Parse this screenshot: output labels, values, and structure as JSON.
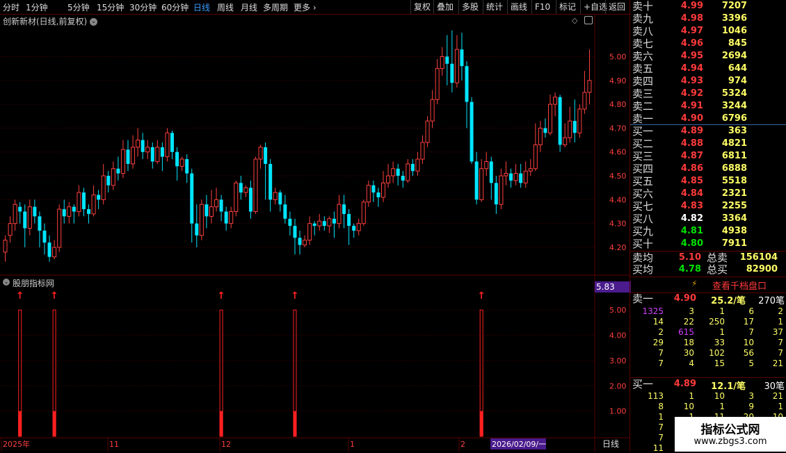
{
  "toolbar": {
    "periods": [
      "分时",
      "1分钟",
      "5分钟",
      "15分钟",
      "30分钟",
      "60分钟",
      "日线",
      "周线",
      "月线",
      "多周期",
      "更多"
    ],
    "active_period": "日线",
    "actions": [
      "复权",
      "叠加",
      "多股",
      "统计",
      "画线",
      "F10",
      "标记",
      "+自选",
      "返回"
    ]
  },
  "stock": {
    "title": "创新新材(日线,前复权)"
  },
  "indicator": {
    "title": "股朋指标网",
    "current_value": "5.83"
  },
  "price_axis": [
    "5.00",
    "4.90",
    "4.80",
    "4.70",
    "4.60",
    "4.50",
    "4.40",
    "4.30",
    "4.20"
  ],
  "ind_axis": [
    "5.00",
    "4.00",
    "3.00",
    "2.00",
    "1.00"
  ],
  "x_axis": {
    "labels": [
      "2025年",
      "11",
      "12",
      "1",
      "2"
    ],
    "cursor_date": "2026/02/09/一",
    "period_label": "日线"
  },
  "orderbook": {
    "asks": [
      {
        "label": "卖十",
        "price": "4.99",
        "vol": "7207"
      },
      {
        "label": "卖九",
        "price": "4.98",
        "vol": "3396"
      },
      {
        "label": "卖八",
        "price": "4.97",
        "vol": "1046"
      },
      {
        "label": "卖七",
        "price": "4.96",
        "vol": "845"
      },
      {
        "label": "卖六",
        "price": "4.95",
        "vol": "2694"
      },
      {
        "label": "卖五",
        "price": "4.94",
        "vol": "644"
      },
      {
        "label": "卖四",
        "price": "4.93",
        "vol": "974"
      },
      {
        "label": "卖三",
        "price": "4.92",
        "vol": "5324"
      },
      {
        "label": "卖二",
        "price": "4.91",
        "vol": "3244"
      },
      {
        "label": "卖一",
        "price": "4.90",
        "vol": "6796"
      }
    ],
    "bids": [
      {
        "label": "买一",
        "price": "4.89",
        "vol": "363",
        "color": "red"
      },
      {
        "label": "买二",
        "price": "4.88",
        "vol": "4821",
        "color": "red"
      },
      {
        "label": "买三",
        "price": "4.87",
        "vol": "6811",
        "color": "red"
      },
      {
        "label": "买四",
        "price": "4.86",
        "vol": "6888",
        "color": "red"
      },
      {
        "label": "买五",
        "price": "4.85",
        "vol": "5518",
        "color": "red"
      },
      {
        "label": "买六",
        "price": "4.84",
        "vol": "2321",
        "color": "red"
      },
      {
        "label": "买七",
        "price": "4.83",
        "vol": "2255",
        "color": "red"
      },
      {
        "label": "买八",
        "price": "4.82",
        "vol": "3364",
        "color": "white"
      },
      {
        "label": "买九",
        "price": "4.81",
        "vol": "4938",
        "color": "green"
      },
      {
        "label": "买十",
        "price": "4.80",
        "vol": "7911",
        "color": "green"
      }
    ],
    "ask_avg_label": "卖均",
    "ask_avg": "5.10",
    "total_ask_label": "总卖",
    "total_ask": "156104",
    "bid_avg_label": "买均",
    "bid_avg": "4.78",
    "total_bid_label": "总买",
    "total_bid": "82900"
  },
  "depth": {
    "button": "查看千档盘口",
    "ask1": {
      "label": "卖一",
      "price": "4.90",
      "avg": "25.2/笔",
      "count": "270笔"
    },
    "ask_rows": [
      [
        "1325",
        "3",
        "1",
        "6",
        "2"
      ],
      [
        "14",
        "22",
        "250",
        "17",
        "1"
      ],
      [
        "2",
        "615",
        "1",
        "7",
        "37"
      ],
      [
        "29",
        "18",
        "33",
        "10",
        "7"
      ],
      [
        "7",
        "30",
        "102",
        "56",
        "7"
      ],
      [
        "7",
        "4",
        "15",
        "5",
        "21"
      ]
    ],
    "bid1": {
      "label": "买一",
      "price": "4.89",
      "avg": "12.1/笔",
      "count": "30笔"
    },
    "bid_rows": [
      [
        "113",
        "1",
        "10",
        "3",
        "21"
      ],
      [
        "8",
        "10",
        "1",
        "9",
        "1"
      ],
      [
        "1",
        "1",
        "11",
        "20",
        "10"
      ],
      [
        "7",
        "",
        "",
        "",
        ""
      ],
      [
        "7",
        "",
        "",
        "",
        ""
      ],
      [
        "11",
        "",
        "",
        "",
        ""
      ]
    ]
  },
  "watermark": {
    "name": "指标公式网",
    "url": "www.zbgs3.com"
  },
  "chart_data": {
    "type": "candlestick",
    "price_range": [
      4.13,
      5.15
    ],
    "candles": [
      [
        4.18,
        4.23,
        4.14,
        4.25
      ],
      [
        4.25,
        4.3,
        4.22,
        4.33
      ],
      [
        4.3,
        4.38,
        4.27,
        4.4
      ],
      [
        4.37,
        4.35,
        4.3,
        4.39
      ],
      [
        4.35,
        4.28,
        4.2,
        4.38
      ],
      [
        4.28,
        4.37,
        4.25,
        4.4
      ],
      [
        4.37,
        4.33,
        4.3,
        4.4
      ],
      [
        4.33,
        4.27,
        4.2,
        4.35
      ],
      [
        4.27,
        4.22,
        4.17,
        4.3
      ],
      [
        4.22,
        4.16,
        4.14,
        4.25
      ],
      [
        4.16,
        4.2,
        4.15,
        4.23
      ],
      [
        4.2,
        4.36,
        4.18,
        4.38
      ],
      [
        4.36,
        4.33,
        4.3,
        4.4
      ],
      [
        4.33,
        4.37,
        4.3,
        4.39
      ],
      [
        4.37,
        4.35,
        4.3,
        4.38
      ],
      [
        4.35,
        4.43,
        4.33,
        4.46
      ],
      [
        4.43,
        4.36,
        4.33,
        4.45
      ],
      [
        4.36,
        4.34,
        4.3,
        4.38
      ],
      [
        4.34,
        4.42,
        4.33,
        4.46
      ],
      [
        4.42,
        4.4,
        4.36,
        4.44
      ],
      [
        4.4,
        4.5,
        4.38,
        4.55
      ],
      [
        4.5,
        4.46,
        4.43,
        4.52
      ],
      [
        4.46,
        4.53,
        4.44,
        4.56
      ],
      [
        4.53,
        4.51,
        4.48,
        4.58
      ],
      [
        4.51,
        4.61,
        4.49,
        4.65
      ],
      [
        4.61,
        4.55,
        4.52,
        4.65
      ],
      [
        4.55,
        4.62,
        4.53,
        4.67
      ],
      [
        4.62,
        4.65,
        4.58,
        4.7
      ],
      [
        4.65,
        4.6,
        4.57,
        4.68
      ],
      [
        4.6,
        4.62,
        4.57,
        4.65
      ],
      [
        4.62,
        4.56,
        4.53,
        4.64
      ],
      [
        4.56,
        4.62,
        4.55,
        4.65
      ],
      [
        4.62,
        4.58,
        4.52,
        4.64
      ],
      [
        4.58,
        4.68,
        4.56,
        4.7
      ],
      [
        4.68,
        4.6,
        4.57,
        4.69
      ],
      [
        4.6,
        4.54,
        4.48,
        4.62
      ],
      [
        4.54,
        4.57,
        4.52,
        4.58
      ],
      [
        4.57,
        4.51,
        4.47,
        4.59
      ],
      [
        4.51,
        4.3,
        4.22,
        4.53
      ],
      [
        4.3,
        4.25,
        4.2,
        4.38
      ],
      [
        4.25,
        4.38,
        4.23,
        4.4
      ],
      [
        4.38,
        4.33,
        4.28,
        4.42
      ],
      [
        4.33,
        4.37,
        4.3,
        4.44
      ],
      [
        4.37,
        4.4,
        4.35,
        4.45
      ],
      [
        4.4,
        4.35,
        4.31,
        4.42
      ],
      [
        4.35,
        4.3,
        4.27,
        4.37
      ],
      [
        4.3,
        4.35,
        4.28,
        4.37
      ],
      [
        4.35,
        4.47,
        4.33,
        4.48
      ],
      [
        4.47,
        4.43,
        4.4,
        4.5
      ],
      [
        4.43,
        4.45,
        4.41,
        4.46
      ],
      [
        4.45,
        4.35,
        4.32,
        4.48
      ],
      [
        4.35,
        4.57,
        4.34,
        4.58
      ],
      [
        4.57,
        4.62,
        4.53,
        4.63
      ],
      [
        4.62,
        4.55,
        4.4,
        4.64
      ],
      [
        4.55,
        4.4,
        4.35,
        4.57
      ],
      [
        4.4,
        4.43,
        4.38,
        4.45
      ],
      [
        4.43,
        4.38,
        4.35,
        4.44
      ],
      [
        4.38,
        4.32,
        4.3,
        4.42
      ],
      [
        4.32,
        4.29,
        4.25,
        4.35
      ],
      [
        4.29,
        4.24,
        4.17,
        4.32
      ],
      [
        4.24,
        4.21,
        4.17,
        4.27
      ],
      [
        4.21,
        4.23,
        4.2,
        4.25
      ],
      [
        4.23,
        4.3,
        4.21,
        4.33
      ],
      [
        4.3,
        4.29,
        4.25,
        4.31
      ],
      [
        4.29,
        4.31,
        4.27,
        4.34
      ],
      [
        4.31,
        4.29,
        4.27,
        4.33
      ],
      [
        4.29,
        4.32,
        4.26,
        4.33
      ],
      [
        4.32,
        4.3,
        4.24,
        4.35
      ],
      [
        4.3,
        4.38,
        4.28,
        4.42
      ],
      [
        4.38,
        4.34,
        4.28,
        4.42
      ],
      [
        4.34,
        4.29,
        4.21,
        4.36
      ],
      [
        4.29,
        4.27,
        4.24,
        4.3
      ],
      [
        4.27,
        4.3,
        4.25,
        4.32
      ],
      [
        4.3,
        4.39,
        4.29,
        4.4
      ],
      [
        4.39,
        4.46,
        4.37,
        4.48
      ],
      [
        4.46,
        4.43,
        4.39,
        4.48
      ],
      [
        4.43,
        4.41,
        4.37,
        4.45
      ],
      [
        4.41,
        4.47,
        4.39,
        4.52
      ],
      [
        4.47,
        4.5,
        4.45,
        4.55
      ],
      [
        4.5,
        4.53,
        4.47,
        4.56
      ],
      [
        4.53,
        4.5,
        4.46,
        4.55
      ],
      [
        4.5,
        4.48,
        4.45,
        4.52
      ],
      [
        4.48,
        4.55,
        4.47,
        4.57
      ],
      [
        4.55,
        4.52,
        4.5,
        4.57
      ],
      [
        4.52,
        4.57,
        4.5,
        4.6
      ],
      [
        4.57,
        4.64,
        4.55,
        4.67
      ],
      [
        4.64,
        4.73,
        4.62,
        4.75
      ],
      [
        4.73,
        4.82,
        4.7,
        4.86
      ],
      [
        4.82,
        4.95,
        4.8,
        4.99
      ],
      [
        4.95,
        5.0,
        4.92,
        5.04
      ],
      [
        5.0,
        4.97,
        4.88,
        5.09
      ],
      [
        4.97,
        4.89,
        4.85,
        5.11
      ],
      [
        4.89,
        5.03,
        4.87,
        5.09
      ],
      [
        5.03,
        4.96,
        4.9,
        5.1
      ],
      [
        4.96,
        4.81,
        4.7,
        4.98
      ],
      [
        4.81,
        4.56,
        4.55,
        4.83
      ],
      [
        4.56,
        4.4,
        4.38,
        4.6
      ],
      [
        4.4,
        4.53,
        4.39,
        4.57
      ],
      [
        4.53,
        4.56,
        4.5,
        4.6
      ],
      [
        4.56,
        4.47,
        4.4,
        4.58
      ],
      [
        4.47,
        4.38,
        4.34,
        4.5
      ],
      [
        4.38,
        4.5,
        4.36,
        4.53
      ],
      [
        4.5,
        4.51,
        4.46,
        4.56
      ],
      [
        4.51,
        4.48,
        4.45,
        4.53
      ],
      [
        4.48,
        4.51,
        4.46,
        4.55
      ],
      [
        4.51,
        4.47,
        4.45,
        4.55
      ],
      [
        4.47,
        4.52,
        4.45,
        4.56
      ],
      [
        4.52,
        4.53,
        4.5,
        4.57
      ],
      [
        4.53,
        4.63,
        4.52,
        4.72
      ],
      [
        4.63,
        4.7,
        4.6,
        4.73
      ],
      [
        4.7,
        4.68,
        4.66,
        4.74
      ],
      [
        4.68,
        4.8,
        4.67,
        4.84
      ],
      [
        4.8,
        4.83,
        4.75,
        4.85
      ],
      [
        4.83,
        4.63,
        4.6,
        4.84
      ],
      [
        4.63,
        4.66,
        4.62,
        4.72
      ],
      [
        4.66,
        4.73,
        4.64,
        4.79
      ],
      [
        4.73,
        4.68,
        4.64,
        4.82
      ],
      [
        4.68,
        4.78,
        4.66,
        4.8
      ],
      [
        4.78,
        4.85,
        4.76,
        4.94
      ],
      [
        4.85,
        4.9,
        4.8,
        5.03
      ]
    ],
    "indicator_signals": [
      3,
      10,
      44,
      59,
      97
    ],
    "indicator_range": [
      0,
      5.83
    ]
  }
}
